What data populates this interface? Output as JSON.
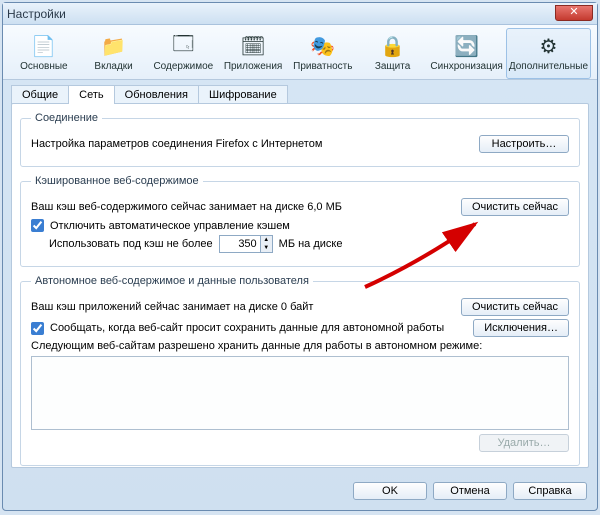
{
  "window": {
    "title": "Настройки"
  },
  "toolbar": {
    "items": [
      {
        "label": "Основные",
        "glyph": "📄"
      },
      {
        "label": "Вкладки",
        "glyph": "📁"
      },
      {
        "label": "Содержимое",
        "glyph": "🗔"
      },
      {
        "label": "Приложения",
        "glyph": "🗓"
      },
      {
        "label": "Приватность",
        "glyph": "🎭"
      },
      {
        "label": "Защита",
        "glyph": "🔒"
      },
      {
        "label": "Синхронизация",
        "glyph": "🔄"
      },
      {
        "label": "Дополнительные",
        "glyph": "⚙"
      }
    ],
    "selected_index": 7
  },
  "subtabs": {
    "items": [
      "Общие",
      "Сеть",
      "Обновления",
      "Шифрование"
    ],
    "active_index": 1
  },
  "connection": {
    "legend": "Соединение",
    "desc": "Настройка параметров соединения Firefox с Интернетом",
    "configure": "Настроить…"
  },
  "cache": {
    "legend": "Кэшированное веб-содержимое",
    "usage": "Ваш кэш веб-содержимого сейчас занимает на диске 6,0 МБ",
    "clear": "Очистить сейчас",
    "override": "Отключить автоматическое управление кэшем",
    "override_checked": true,
    "limit_prefix": "Использовать под кэш не более",
    "limit_value": "350",
    "limit_suffix": "МБ на диске"
  },
  "offline": {
    "legend": "Автономное веб-содержимое и данные пользователя",
    "usage": "Ваш кэш приложений сейчас занимает на диске 0 байт",
    "clear": "Очистить сейчас",
    "notify": "Сообщать, когда веб-сайт просит сохранить данные для автономной работы",
    "notify_checked": true,
    "exceptions": "Исключения…",
    "listlabel": "Следующим веб-сайтам разрешено хранить данные для работы в автономном режиме:",
    "remove": "Удалить…"
  },
  "footer": {
    "ok": "OK",
    "cancel": "Отмена",
    "help": "Справка"
  }
}
